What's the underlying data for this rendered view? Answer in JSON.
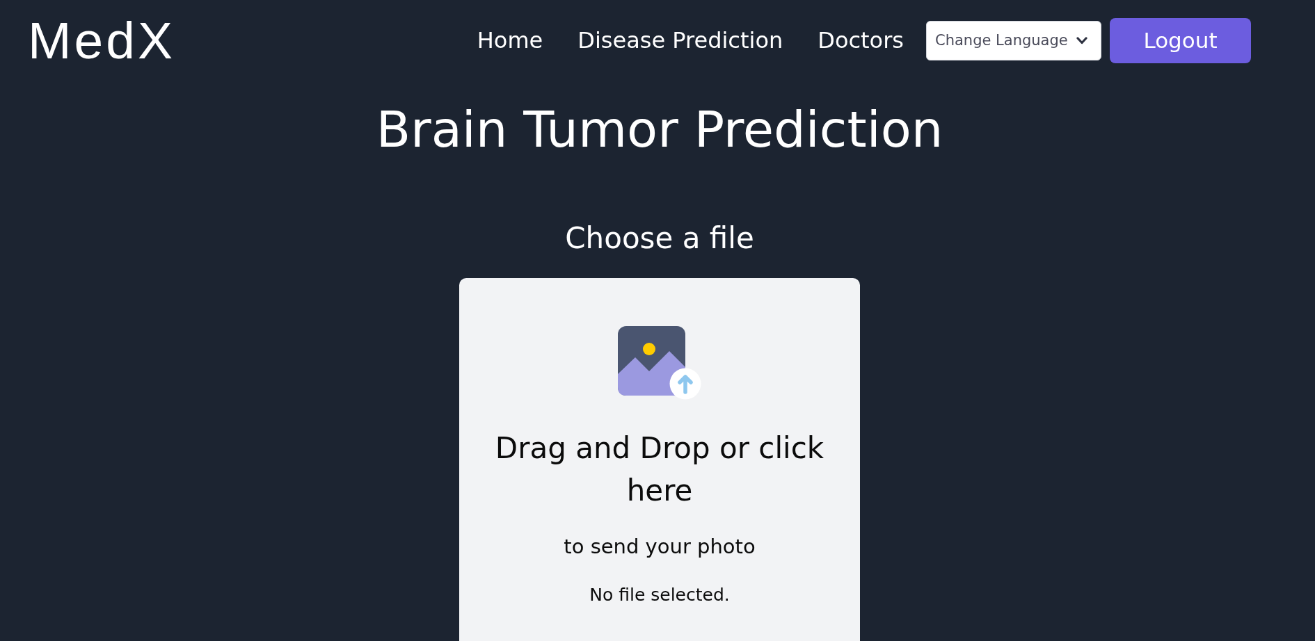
{
  "header": {
    "logo": "MedX",
    "nav_links": [
      {
        "label": "Home"
      },
      {
        "label": "Disease Prediction"
      },
      {
        "label": "Doctors"
      }
    ],
    "language_select": {
      "value": "Change Language"
    },
    "logout_button": "Logout"
  },
  "page": {
    "title": "Brain Tumor Prediction",
    "upload": {
      "label": "Choose a file",
      "dropzone_title": "Drag and Drop or click here",
      "dropzone_subtitle": "to send your photo",
      "file_status": "No file selected."
    }
  }
}
